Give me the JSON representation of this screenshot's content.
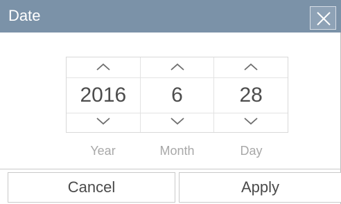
{
  "dialog": {
    "title": "Date",
    "close_icon": "close-icon"
  },
  "picker": {
    "columns": [
      {
        "value": "2016",
        "label": "Year",
        "up_icon": "chevron-up-icon",
        "down_icon": "chevron-down-icon"
      },
      {
        "value": "6",
        "label": "Month",
        "up_icon": "chevron-up-icon",
        "down_icon": "chevron-down-icon"
      },
      {
        "value": "28",
        "label": "Day",
        "up_icon": "chevron-up-icon",
        "down_icon": "chevron-down-icon"
      }
    ]
  },
  "footer": {
    "cancel_label": "Cancel",
    "apply_label": "Apply"
  },
  "colors": {
    "titlebar": "#7b92a8",
    "value_text": "#4d4d4d",
    "label_text": "#a8a8a8"
  }
}
